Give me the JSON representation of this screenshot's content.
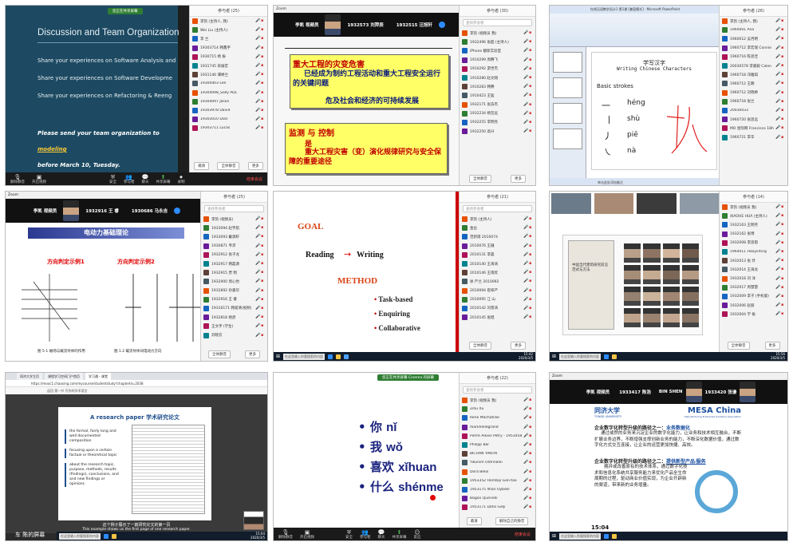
{
  "colors": {
    "zoom_green": "#2e7d32",
    "mute_red": "#d23c3c",
    "slide_blue": "#1e4e6a",
    "accent_red": "#c00000",
    "goal_orange": "#d84315"
  },
  "panel_common": {
    "invite": "邀请",
    "mute_all": "全体静音",
    "more": "更多"
  },
  "zoom_bar": {
    "mute": "解除静音",
    "video": "开启视频",
    "security": "安全",
    "participants": "参与者",
    "chat": "聊天",
    "share": "共享屏幕",
    "record": "录制",
    "reactions": "反应",
    "leave": "结束会议"
  },
  "taskbar": {
    "search": "在这里输入你要搜索的内容"
  },
  "tile1": {
    "share_pill": "您正在共享屏幕",
    "title": "Discussion and Team Organization",
    "bullets": [
      "Share your experiences on Software Analysis and",
      "Share your experiences on Software Developme",
      "Share your experiences on Refactoring & Reeng"
    ],
    "footer_a": "Please send your team organization to ",
    "footer_link": "modeling",
    "footer_b": "before March 10, Tuesday.",
    "panel_title": "参与者 (25)",
    "rows": [
      "李凯 (主持人, 我)",
      "Wei Liu (主持人)",
      "李 兰",
      "19303714 韩鑫宇",
      "1930715 杨 振",
      "1931745 宋展宏",
      "1931146 谭婷兰",
      "19304403 Lee",
      "19304098_Sally PDL",
      "19304097 Jason",
      "19303978 David",
      "19303010 Dian",
      "19303711 Lucas"
    ]
  },
  "tile2": {
    "app": "Zoom",
    "videos": [
      "李凯 视频员",
      "1932573 刘羿辰",
      "1932515 汪旭轩"
    ],
    "box1_title": "重大工程的灾变危害",
    "box1_l1": "已经成为制约工程活动和重大工程安全运行的关键问题",
    "box1_l2": "危及社会和经济的可持续发展",
    "box2_title": "监测 与 控制",
    "box2_is": "是",
    "box2_text": "重大工程灾害（变）演化规律研究与安全保障的重要途径",
    "panel_title": "参与者 (30)",
    "search": "查找参会者",
    "rows": [
      "李凯 (视频员 我)",
      "1932496 张超 (主持人)",
      "iPhone 翻新实验室",
      "1910299 周腾飞",
      "1910292 游世杰",
      "1910280 赵文翔",
      "1910283 韩腾",
      "1910423 王猛",
      "1932171 张浩杰",
      "1932234 杨哲远",
      "1932255 李明亮",
      "1932250 高兴"
    ]
  },
  "tile3": {
    "title_bar": "在线汉语教学设计1 第1课 [兼容模式] - Microsoft PowerPoint",
    "slide_title": "学写汉字",
    "slide_sub": "Writing Chinese Characters",
    "strokes_label": "Basic strokes",
    "pinyin": [
      "héng",
      "shù",
      "piē",
      "nà"
    ],
    "status": "单击此处添加备注",
    "panel_title": "参与者 (26)",
    "rows": [
      "李凯 (主持人, 我)",
      "1960001 Ana",
      "1960012 吴月明",
      "1960712 李宏瑞 Connie",
      "1960716 陈思佳",
      "20030578 李嘉毅 Calen",
      "1960718 邓雅琪",
      "1960712 王朗",
      "1960712 刘晓婷",
      "1960718 张兰",
      "20030033",
      "1960720 张思远",
      "MO 星际网 Francisco 18h",
      "1960721 李华"
    ]
  },
  "tile4": {
    "app": "Zoom",
    "videos": [
      "李凯 视频员",
      "1932916 王 睿",
      "1930686 马永吉"
    ],
    "slide_title": "电动力基础理论",
    "caption_left": "方向判定示例1",
    "caption_right": "方向判定示例2",
    "fig1": "图 5-1   磁场与载流导体的作用",
    "fig2": "图 1.2   载流导体间电动力方向",
    "panel_title": "参与者 (25)",
    "search": "查找参会者",
    "rows": [
      "李凯 (视频员)",
      "1933094 赵宇航",
      "1933093 戴源轩",
      "1930871 韦沛",
      "1932912 张子龙",
      "1932917 韩磊源",
      "1932915 贾 明",
      "1932900 周心怡",
      "1932892 孙嘉华",
      "1932916 王 睿",
      "19316171 韩俊清(视频)",
      "1932818 杨彦",
      "王文宇 (学生)",
      "刘晓云"
    ]
  },
  "tile5": {
    "goal": "GOAL",
    "reading": "Reading",
    "writing": "Writing",
    "method": "METHOD",
    "methods": [
      "Task-based",
      "Enquiring",
      "Collaborative"
    ],
    "panel_title": "参与者 (21)",
    "search": "查找参会者",
    "rows": [
      "李凯 (主持人)",
      "金岳",
      "范新雨 2010074",
      "2010076 王珊",
      "2010131 李晨",
      "2010140 王海涛",
      "2010146 王雨欣",
      "徐 严兰 2010092",
      "2010094 崔梓严",
      "2010095 江 山",
      "2010142 刘景涛",
      "2010145 张旭"
    ],
    "clock": "15:42\n2020/3/5"
  },
  "tile6": {
    "book_title": "中国当代建筑研究前沿范式与方法",
    "panel_title": "参与者 (14)",
    "rows": [
      "李凯 (视频员 我)",
      "XIAOHE HUA (主持人)",
      "1932163 王明月",
      "1932162 张博",
      "1932008 李思雨",
      "1964011 Haoyinting",
      "1932013 张 玲",
      "1932014 王海龙",
      "1932018 刘 洋",
      "1932017 周慧慧",
      "1932009 李子 (手机版)",
      "1932006 赵丽",
      "1932004 学 振"
    ],
    "clock": "15:56\n2020/3/5"
  },
  "tile7": {
    "tabs": [
      "同济大学主页",
      "课程学习空间门户首页",
      "学习通 - 课堂"
    ],
    "url": "https://mooc1.chaoxing.com/mycourse/studentstudy?chapterId=2038",
    "breadcrumb": "返回   第一节 写作的学术语言",
    "slide_title": "A research paper 学术研究论文",
    "bullets": [
      "the formal, fairly long and well documented composition",
      "focusing upon a certain factual or theoretical topic",
      "about the research topic, purpose, methods, results (findings), conclusions, and and new findings or opinions"
    ],
    "subtitle1": "这个例子展示了一篇研究论文的第一页",
    "subtitle2": "This example shows us the first page of one research paper.",
    "watermark": "车 陈的屏幕",
    "clock": "15:04\n2020/3/5"
  },
  "tile8": {
    "share_pill": "您正在共享屏幕 Cinema 的屏幕",
    "words": [
      {
        "zh": "你",
        "py": "nǐ"
      },
      {
        "zh": "我",
        "py": "wǒ"
      },
      {
        "zh": "喜欢",
        "py": "xǐhuan"
      },
      {
        "zh": "什么",
        "py": "shénme"
      }
    ],
    "panel_title": "参与者 (22)",
    "search": "查找参会者",
    "rows": [
      "李凯 (视频员 我)",
      "Zihu Xu",
      "Rene Machatcke",
      "markhellegrand",
      "Pierre Alexis Pétry - 1953458",
      "Philipp Bär",
      "BICHAN YANTAI",
      "Yikunim Oldrinalei",
      "Dora Beloï",
      "1953352 Hornbip Gan-tao",
      "1953175 Ilhan Oybekl",
      "Bogon Querielli",
      "1953171 Datis Gelji"
    ],
    "invite": "邀请",
    "mute_all": "解除自己的静音"
  },
  "tile9": {
    "app": "Zoom",
    "videos": [
      "李凯 视频员",
      "1933417 陈浩",
      "BIN SHEN",
      "1933420 张谦"
    ],
    "logo_left": "同济大学",
    "logo_left_en": "TONGJI UNIVERSITY",
    "logo_right": "MESA China",
    "logo_right_sub": "Manufacturing Enterprise Solutions Association",
    "h1_a": "企业数字化转型升级的路径之一：",
    "h1_b": "业务数据化",
    "p1": "通过或然的业务来沉淀企业的数字化能力，让业务和技术相互融合，不断扩展业务边界，不断增强支撑创新业务的能力，不断深化数据价值，通过数字化方式交互连接，让企业的运营更加快捷、高效。",
    "h2_a": "企业数字化转型升级的路径之二：",
    "h2_b": "提供新型产品/服务",
    "p2": "拥并或改善原有的技术体系，通过数字化技术和信息化系统共享服务能力来优化产品全生命周期的过程，驱动商业价值实现，为企业开辟新的渠道，带来新的业务增量。",
    "clock": "15:04"
  }
}
